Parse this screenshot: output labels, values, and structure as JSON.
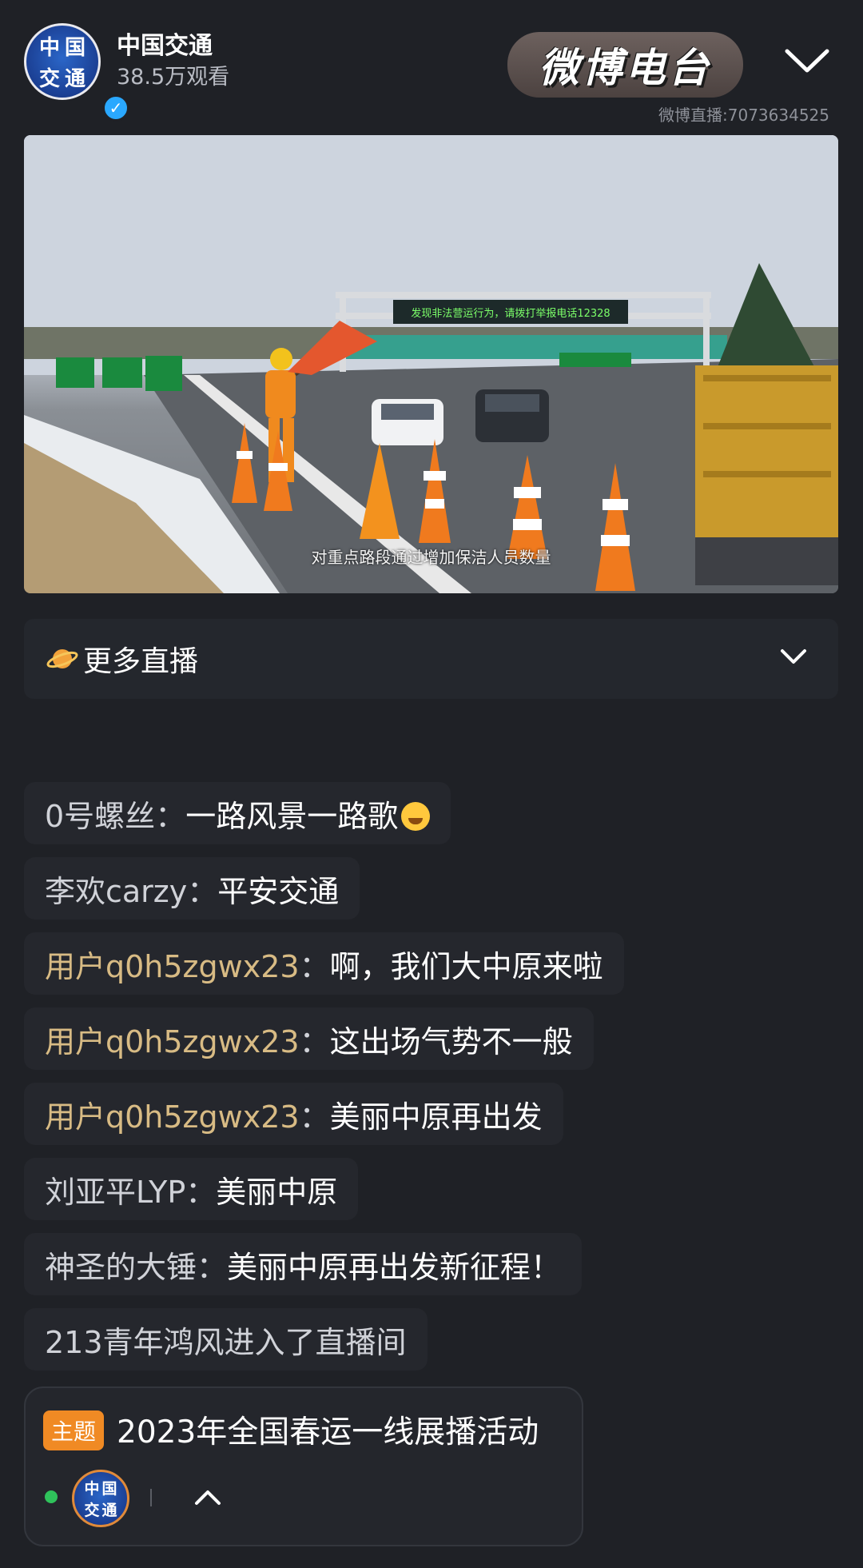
{
  "header": {
    "anchor_name": "中国交通",
    "viewers": "38.5万观看",
    "avatar_chars": [
      "中",
      "国",
      "交",
      "通"
    ],
    "radio_badge": "微博电台",
    "room_id": "微博直播:7073634525"
  },
  "video": {
    "subtitle": "对重点路段通过增加保洁人员数量",
    "sign_text": "发现非法营运行为，请拨打举报电话12328"
  },
  "more_live": {
    "label": "更多直播"
  },
  "comments": [
    {
      "user": "0号螺丝",
      "sep": "：",
      "text": "一路风景一路歌"
    },
    {
      "user": "李欢carzy",
      "sep": "：",
      "text": "平安交通"
    },
    {
      "user": "用户q0h5zgwx23",
      "sep": "：",
      "text": "啊，我们大中原来啦"
    },
    {
      "user": "用户q0h5zgwx23",
      "sep": "：",
      "text": "这出场气势不一般"
    },
    {
      "user": "用户q0h5zgwx23",
      "sep": "：",
      "text": "美丽中原再出发"
    },
    {
      "user": "刘亚平LYP",
      "sep": "：",
      "text": "美丽中原"
    },
    {
      "user": "神圣的大锤",
      "sep": "：",
      "text": "美丽中原再出发新征程！"
    },
    {
      "text": "213青年鸿风进入了直播间"
    }
  ],
  "topic": {
    "badge": "主题",
    "title": "2023年全国春运一线展播活动"
  },
  "colors": {
    "background": "#1f2126",
    "comment_bg": "#25272d",
    "gold_user": "#d8bb84",
    "topic_badge": "#f08a24",
    "online_green": "#2fc25b"
  }
}
